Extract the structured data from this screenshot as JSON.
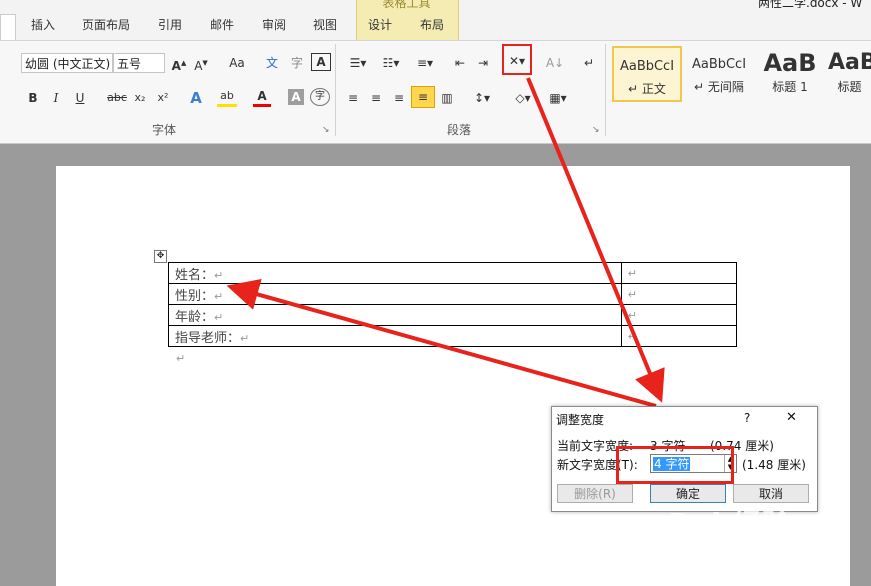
{
  "window": {
    "title_fragment": "两性二学.docx - W"
  },
  "tabs": [
    {
      "label": "插入"
    },
    {
      "label": "页面布局"
    },
    {
      "label": "引用"
    },
    {
      "label": "邮件"
    },
    {
      "label": "审阅"
    },
    {
      "label": "视图"
    },
    {
      "label": "设计"
    },
    {
      "label": "布局"
    }
  ],
  "contextual_tab": {
    "title": "表格工具"
  },
  "font": {
    "name": "幼圆 (中文正文)",
    "size": "五号",
    "group_label": "字体",
    "buttons": [
      "B",
      "I",
      "U",
      "abc",
      "x₂",
      "x²",
      "Aa",
      "A",
      "A"
    ]
  },
  "paragraph": {
    "group_label": "段落"
  },
  "styles": [
    {
      "sample": "AaBbCcI",
      "name": "正文"
    },
    {
      "sample": "AaBbCcI",
      "name": "无间隔"
    },
    {
      "sample": "AaB",
      "name": "标题 1"
    },
    {
      "sample": "AaB",
      "name": "标题"
    }
  ],
  "document": {
    "rows": [
      {
        "label": "姓名：",
        "value": ""
      },
      {
        "label": "性别：",
        "value": ""
      },
      {
        "label": "年龄：",
        "value": ""
      },
      {
        "label": "指导老师：",
        "value": ""
      }
    ],
    "return_mark": "↵"
  },
  "dialog": {
    "title": "调整宽度",
    "help": "?",
    "close": "✕",
    "current_label": "当前文字宽度:",
    "current_value": "3 字符",
    "current_cm": "(0.74 厘米)",
    "new_label": "新文字宽度(T):",
    "new_value": "4 字符",
    "new_cm": "(1.48 厘米)",
    "delete_btn": "删除(R)",
    "ok_btn": "确定",
    "cancel_btn": "取消"
  },
  "watermark": {
    "brand": "Bai 经验",
    "url": "jingyan.baidu.com"
  },
  "colors": {
    "highlight_red": "#e8231c",
    "tab_yellow": "#f5ecb4"
  }
}
